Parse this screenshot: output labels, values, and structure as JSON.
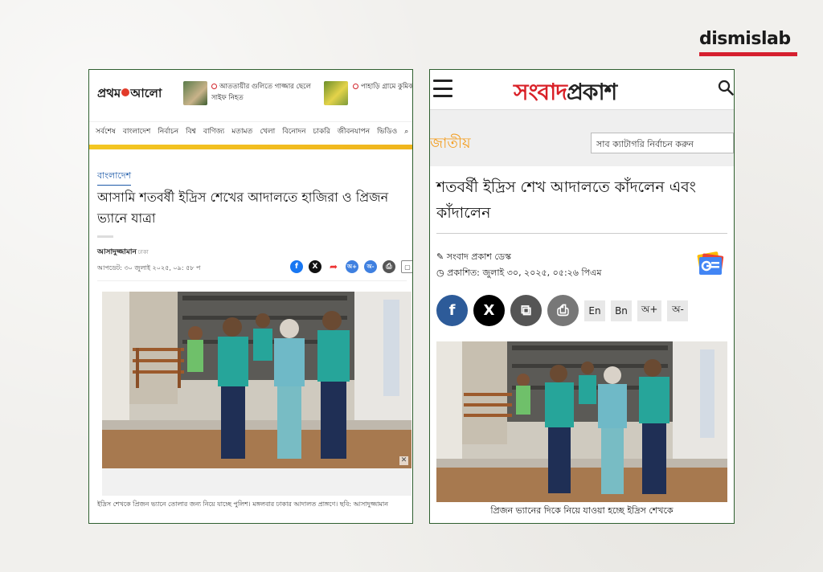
{
  "brand": {
    "name": "dismislab"
  },
  "left": {
    "logo": [
      "প্রথম",
      "আলো"
    ],
    "header_news": [
      {
        "text": "আততায়ীর গুলিতে গাজ্জার ছেলে সাইফ নিহত"
      },
      {
        "text": "পাহাড়ি গ্রামে কুমিকাড়া"
      }
    ],
    "nav": [
      "সর্বশেষ",
      "বাংলাদেশ",
      "নির্বাচন",
      "বিশ্ব",
      "বাণিজ্য",
      "মতামত",
      "খেলা",
      "বিনোদন",
      "চাকরি",
      "জীবনযাপন",
      "ভিডিও"
    ],
    "category": "বাংলাদেশ",
    "title": "আসামি শতবর্ষী ইদ্রিস শেখের আদালতে হাজিরা ও প্রিজন ভ্যানে যাত্রা",
    "author": "আসাদুজ্জামান",
    "author_location": "ঢাকা",
    "updated": "আপডেট: ৩০ জুলাই ২০২৫, ০৯: ৫৮ প",
    "share_labels": {
      "fb": "f",
      "tw": "X",
      "sh": "➦",
      "ap": "অ+",
      "am": "অ-",
      "pr": "⎙",
      "bk": "▢"
    },
    "photo_close": "✕",
    "caption": "ইদ্রিস শেখকে প্রিজন ভ্যানে তোলার জন্য নিয়ে যাচ্ছে পুলিশ। মঙ্গলবার ঢাকার আদালত প্রাঙ্গণে। ছবি: আসাদুজ্জামান"
  },
  "right": {
    "logo_a": "সংবাদ",
    "logo_b": "প্রকাশ",
    "category": "জাতীয়",
    "subcategory_placeholder": "সাব ক্যাটাগরি নির্বাচন করুন",
    "title": "শতবর্ষী ইদ্রিস শেখ আদালতে কাঁদলেন এবং কাঁদালেন",
    "author": "সংবাদ প্রকাশ ডেস্ক",
    "published": "প্রকাশিত: জুলাই ৩০, ২০২৫, ০৫:২৬ পিএম",
    "share_labels": {
      "fb": "f",
      "tw": "X",
      "cp": "⧉",
      "pr": "⎙"
    },
    "text_buttons": [
      "En",
      "Bn",
      "অ+",
      "অ-"
    ],
    "caption": "প্রিজন ভ্যানের দিকে নিয়ে যাওয়া হচ্ছে ইদ্রিস শেখকে"
  }
}
